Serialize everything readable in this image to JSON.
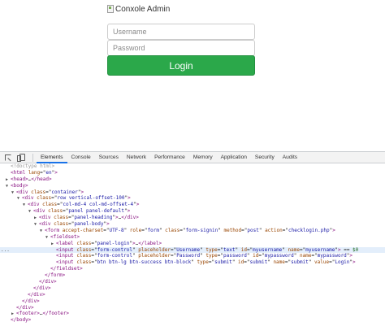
{
  "page": {
    "logo_alt": "Conxole Admin",
    "username_placeholder": "Username",
    "password_placeholder": "Password",
    "login_label": "Login"
  },
  "devtools": {
    "tabs": [
      "Elements",
      "Console",
      "Sources",
      "Network",
      "Performance",
      "Memory",
      "Application",
      "Security",
      "Audits"
    ],
    "active_tab": "Elements"
  },
  "dom_lines": [
    {
      "indent": 0,
      "tri": "",
      "html": "<span class=\"d\">&lt;!doctype html&gt;</span>"
    },
    {
      "indent": 0,
      "tri": "",
      "html": "<span class=\"t\">&lt;html</span> <span class=\"a\">lang</span>=\"<span class=\"v\">en</span>\"<span class=\"t\">&gt;</span>"
    },
    {
      "indent": 0,
      "tri": "▶",
      "html": "<span class=\"t\">&lt;head&gt;</span>…<span class=\"t\">&lt;/head&gt;</span>"
    },
    {
      "indent": 0,
      "tri": "▼",
      "html": "<span class=\"t\">&lt;body&gt;</span>"
    },
    {
      "indent": 1,
      "tri": "▼",
      "html": "<span class=\"t\">&lt;div</span> <span class=\"a\">class</span>=\"<span class=\"v\">container</span>\"<span class=\"t\">&gt;</span>"
    },
    {
      "indent": 2,
      "tri": "▼",
      "html": "<span class=\"t\">&lt;div</span> <span class=\"a\">class</span>=\"<span class=\"v\">row vertical-offset-100</span>\"<span class=\"t\">&gt;</span>"
    },
    {
      "indent": 3,
      "tri": "▼",
      "html": "<span class=\"t\">&lt;div</span> <span class=\"a\">class</span>=\"<span class=\"v\">col-md-4 col-md-offset-4</span>\"<span class=\"t\">&gt;</span>"
    },
    {
      "indent": 4,
      "tri": "▼",
      "html": "<span class=\"t\">&lt;div</span> <span class=\"a\">class</span>=\"<span class=\"v\">panel panel-default</span>\"<span class=\"t\">&gt;</span>"
    },
    {
      "indent": 5,
      "tri": "▶",
      "html": "<span class=\"t\">&lt;div</span> <span class=\"a\">class</span>=\"<span class=\"v\">panel-heading</span>\"<span class=\"t\">&gt;</span>…<span class=\"t\">&lt;/div&gt;</span>"
    },
    {
      "indent": 5,
      "tri": "▼",
      "html": "<span class=\"t\">&lt;div</span> <span class=\"a\">class</span>=\"<span class=\"v\">panel-body</span>\"<span class=\"t\">&gt;</span>"
    },
    {
      "indent": 6,
      "tri": "▼",
      "html": "<span class=\"t\">&lt;form</span> <span class=\"a\">accept-charset</span>=\"<span class=\"v\">UTF-8</span>\" <span class=\"a\">role</span>=\"<span class=\"v\">form</span>\" <span class=\"a\">class</span>=\"<span class=\"v\">form-signin</span>\" <span class=\"a\">method</span>=\"<span class=\"v\">post</span>\" <span class=\"a\">action</span>=\"<span class=\"v\">checklogin.php</span>\"<span class=\"t\">&gt;</span>"
    },
    {
      "indent": 7,
      "tri": "▼",
      "html": "<span class=\"t\">&lt;fieldset&gt;</span>"
    },
    {
      "indent": 8,
      "tri": "▶",
      "html": "<span class=\"t\">&lt;label</span> <span class=\"a\">class</span>=\"<span class=\"v\">panel-login</span>\"<span class=\"t\">&gt;</span>…<span class=\"t\">&lt;/label&gt;</span>"
    },
    {
      "indent": 8,
      "tri": "",
      "selected": true,
      "html": "<span class=\"t\">&lt;input</span> <span class=\"a\">class</span>=\"<span class=\"v\">form-control</span>\" <span class=\"a\">placeholder</span>=\"<span class=\"v\">Username</span>\" <span class=\"a\">type</span>=\"<span class=\"v\">text</span>\" <span class=\"a\">id</span>=\"<span class=\"v\">myusername</span>\" <span class=\"a\">name</span>=\"<span class=\"v\">myusername</span>\"<span class=\"t\">&gt;</span> == <span class=\"c\">$0</span>"
    },
    {
      "indent": 8,
      "tri": "",
      "html": "<span class=\"t\">&lt;input</span> <span class=\"a\">class</span>=\"<span class=\"v\">form-control</span>\" <span class=\"a\">placeholder</span>=\"<span class=\"v\">Password</span>\" <span class=\"a\">type</span>=\"<span class=\"v\">password</span>\" <span class=\"a\">id</span>=\"<span class=\"v\">mypassword</span>\" <span class=\"a\">name</span>=\"<span class=\"v\">mypassword</span>\"<span class=\"t\">&gt;</span>"
    },
    {
      "indent": 8,
      "tri": "",
      "html": "<span class=\"t\">&lt;input</span> <span class=\"a\">class</span>=\"<span class=\"v\">btn btn-lg btn-success btn-block</span>\" <span class=\"a\">type</span>=\"<span class=\"v\">submit</span>\" <span class=\"a\">id</span>=\"<span class=\"v\">submit</span>\" <span class=\"a\">name</span>=\"<span class=\"v\">submit</span>\" <span class=\"a\">value</span>=\"<span class=\"v\">Login</span>\"<span class=\"t\">&gt;</span>"
    },
    {
      "indent": 7,
      "tri": "",
      "html": "<span class=\"t\">&lt;/fieldset&gt;</span>"
    },
    {
      "indent": 6,
      "tri": "",
      "html": "<span class=\"t\">&lt;/form&gt;</span>"
    },
    {
      "indent": 5,
      "tri": "",
      "html": "<span class=\"t\">&lt;/div&gt;</span>"
    },
    {
      "indent": 4,
      "tri": "",
      "html": "<span class=\"t\">&lt;/div&gt;</span>"
    },
    {
      "indent": 3,
      "tri": "",
      "html": "<span class=\"t\">&lt;/div&gt;</span>"
    },
    {
      "indent": 2,
      "tri": "",
      "html": "<span class=\"t\">&lt;/div&gt;</span>"
    },
    {
      "indent": 1,
      "tri": "",
      "html": "<span class=\"t\">&lt;/div&gt;</span>"
    },
    {
      "indent": 1,
      "tri": "▶",
      "html": "<span class=\"t\">&lt;footer&gt;</span>…<span class=\"t\">&lt;/footer&gt;</span>"
    },
    {
      "indent": 0,
      "tri": "",
      "html": "<span class=\"t\">&lt;/body&gt;</span>"
    }
  ],
  "colors": {
    "login_button": "#2ba84a",
    "selection": "#e3eefb",
    "active_tab_underline": "#1a73e8"
  }
}
